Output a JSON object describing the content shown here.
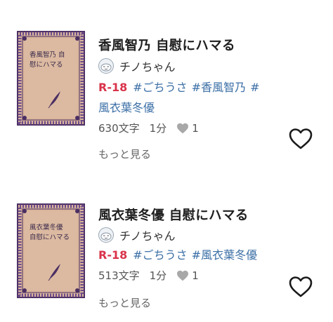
{
  "items": [
    {
      "cover_title": "香風智乃 自慰にハマる",
      "title": "香風智乃 自慰にハマる",
      "author": "チノちゃん",
      "rating": "R-18",
      "tags": [
        "#ごちうさ",
        "#香風智乃",
        "#",
        "風衣葉冬優"
      ],
      "chars": "630文字",
      "read_time": "1分",
      "likes": "1",
      "more": "もっと見る"
    },
    {
      "cover_title": "風衣葉冬優 自慰にハマる",
      "title": "風衣葉冬優 自慰にハマる",
      "author": "チノちゃん",
      "rating": "R-18",
      "tags": [
        "#ごちうさ",
        "#風衣葉冬優"
      ],
      "chars": "513文字",
      "read_time": "1分",
      "likes": "1",
      "more": "もっと見る"
    }
  ],
  "colors": {
    "rating": "#d9334a",
    "tag": "#3b6fa6",
    "cover_bg": "#d9b59c",
    "cover_border": "#4b2f63"
  },
  "icons": {
    "like": "heart-outline-icon",
    "likes_count": "heart-filled-icon",
    "cover_ornament": "feather-quill-icon",
    "avatar": "avatar-face-icon"
  }
}
